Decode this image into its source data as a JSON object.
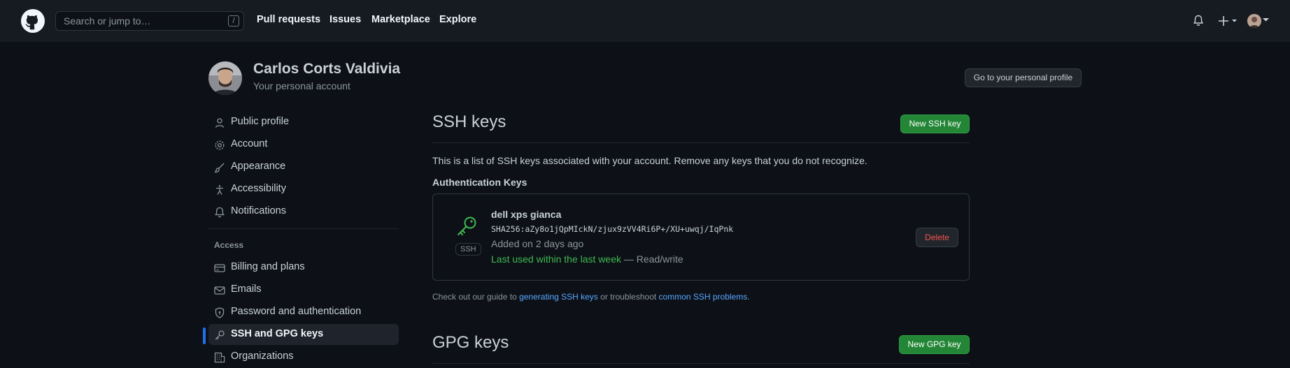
{
  "header": {
    "search_placeholder": "Search or jump to…",
    "search_shortcut": "/",
    "nav": [
      "Pull requests",
      "Issues",
      "Marketplace",
      "Explore"
    ]
  },
  "profile": {
    "name": "Carlos Corts Valdivia",
    "subtitle": "Your personal account",
    "go_to_profile": "Go to your personal profile"
  },
  "sidebar": {
    "items": [
      {
        "label": "Public profile",
        "icon": "person-icon"
      },
      {
        "label": "Account",
        "icon": "gear-icon"
      },
      {
        "label": "Appearance",
        "icon": "paintbrush-icon"
      },
      {
        "label": "Accessibility",
        "icon": "accessibility-icon"
      },
      {
        "label": "Notifications",
        "icon": "bell-icon"
      }
    ],
    "access_heading": "Access",
    "access_items": [
      {
        "label": "Billing and plans",
        "icon": "credit-card-icon"
      },
      {
        "label": "Emails",
        "icon": "mail-icon"
      },
      {
        "label": "Password and authentication",
        "icon": "shield-lock-icon"
      },
      {
        "label": "SSH and GPG keys",
        "icon": "key-icon",
        "selected": true
      },
      {
        "label": "Organizations",
        "icon": "organization-icon"
      }
    ]
  },
  "ssh": {
    "title": "SSH keys",
    "new_button": "New SSH key",
    "description": "This is a list of SSH keys associated with your account. Remove any keys that you do not recognize.",
    "auth_heading": "Authentication Keys",
    "key": {
      "badge": "SSH",
      "title": "dell xps gianca",
      "fingerprint": "SHA256:aZy8o1jQpMIckN/zjux9zVV4Ri6P+/XU+uwqj/IqPnk",
      "added": "Added on 2 days ago",
      "last_used": "Last used within the last week",
      "access": " — Read/write",
      "delete_button": "Delete"
    },
    "guide": {
      "prefix": "Check out our guide to ",
      "link1": "generating SSH keys",
      "middle": " or troubleshoot ",
      "link2": "common SSH problems",
      "suffix": "."
    }
  },
  "gpg": {
    "title": "GPG keys",
    "new_button": "New GPG key"
  },
  "colors": {
    "background": "#0d1117",
    "header": "#161b22",
    "accent_green": "#238636",
    "link": "#58a6ff",
    "danger": "#f85149",
    "selected_accent": "#1f6feb"
  }
}
